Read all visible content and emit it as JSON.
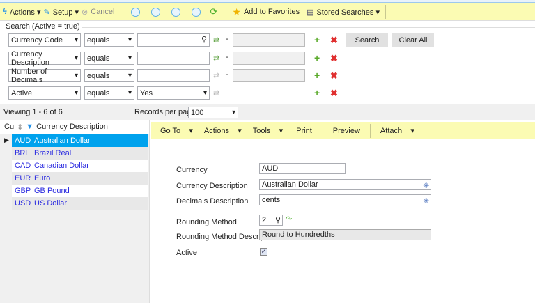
{
  "toolbar": {
    "actions": "Actions",
    "setup": "Setup",
    "cancel": "Cancel",
    "favorites": "Add to Favorites",
    "stored": "Stored Searches"
  },
  "search": {
    "title": "Search (Active = true)",
    "search_btn": "Search",
    "clear_btn": "Clear All",
    "dash": "-",
    "rows": [
      {
        "field": "Currency Code",
        "op": "equals",
        "value": ""
      },
      {
        "field": "Currency Description",
        "op": "equals",
        "value": ""
      },
      {
        "field": "Number of Decimals",
        "op": "equals",
        "value": ""
      },
      {
        "field": "Active",
        "op": "equals",
        "value": "Yes"
      }
    ]
  },
  "paging": {
    "viewing": "Viewing 1 - 6 of 6",
    "rpp_label": "Records per page:",
    "rpp": "100"
  },
  "list": {
    "col1": "Cu",
    "col2": "Currency Description",
    "rows": [
      {
        "code": "AUD",
        "desc": "Australian Dollar"
      },
      {
        "code": "BRL",
        "desc": "Brazil Real"
      },
      {
        "code": "CAD",
        "desc": "Canadian Dollar"
      },
      {
        "code": "EUR",
        "desc": "Euro"
      },
      {
        "code": "GBP",
        "desc": "GB Pound"
      },
      {
        "code": "USD",
        "desc": "US Dollar"
      }
    ]
  },
  "detail_toolbar": {
    "goto": "Go To",
    "actions": "Actions",
    "tools": "Tools",
    "print": "Print",
    "preview": "Preview",
    "attach": "Attach"
  },
  "form": {
    "currency_label": "Currency",
    "currency": "AUD",
    "desc_label": "Currency Description",
    "desc": "Australian Dollar",
    "dec_label": "Decimals Description",
    "dec": "cents",
    "round_label": "Rounding Method",
    "round": "2",
    "round_desc_label": "Rounding Method Description",
    "round_desc": "Round to Hundredths",
    "active_label": "Active",
    "active": true
  },
  "colors": {
    "toolbar": "#fbfbb3",
    "selected": "#00a2ed",
    "link": "#2a2ae0"
  }
}
